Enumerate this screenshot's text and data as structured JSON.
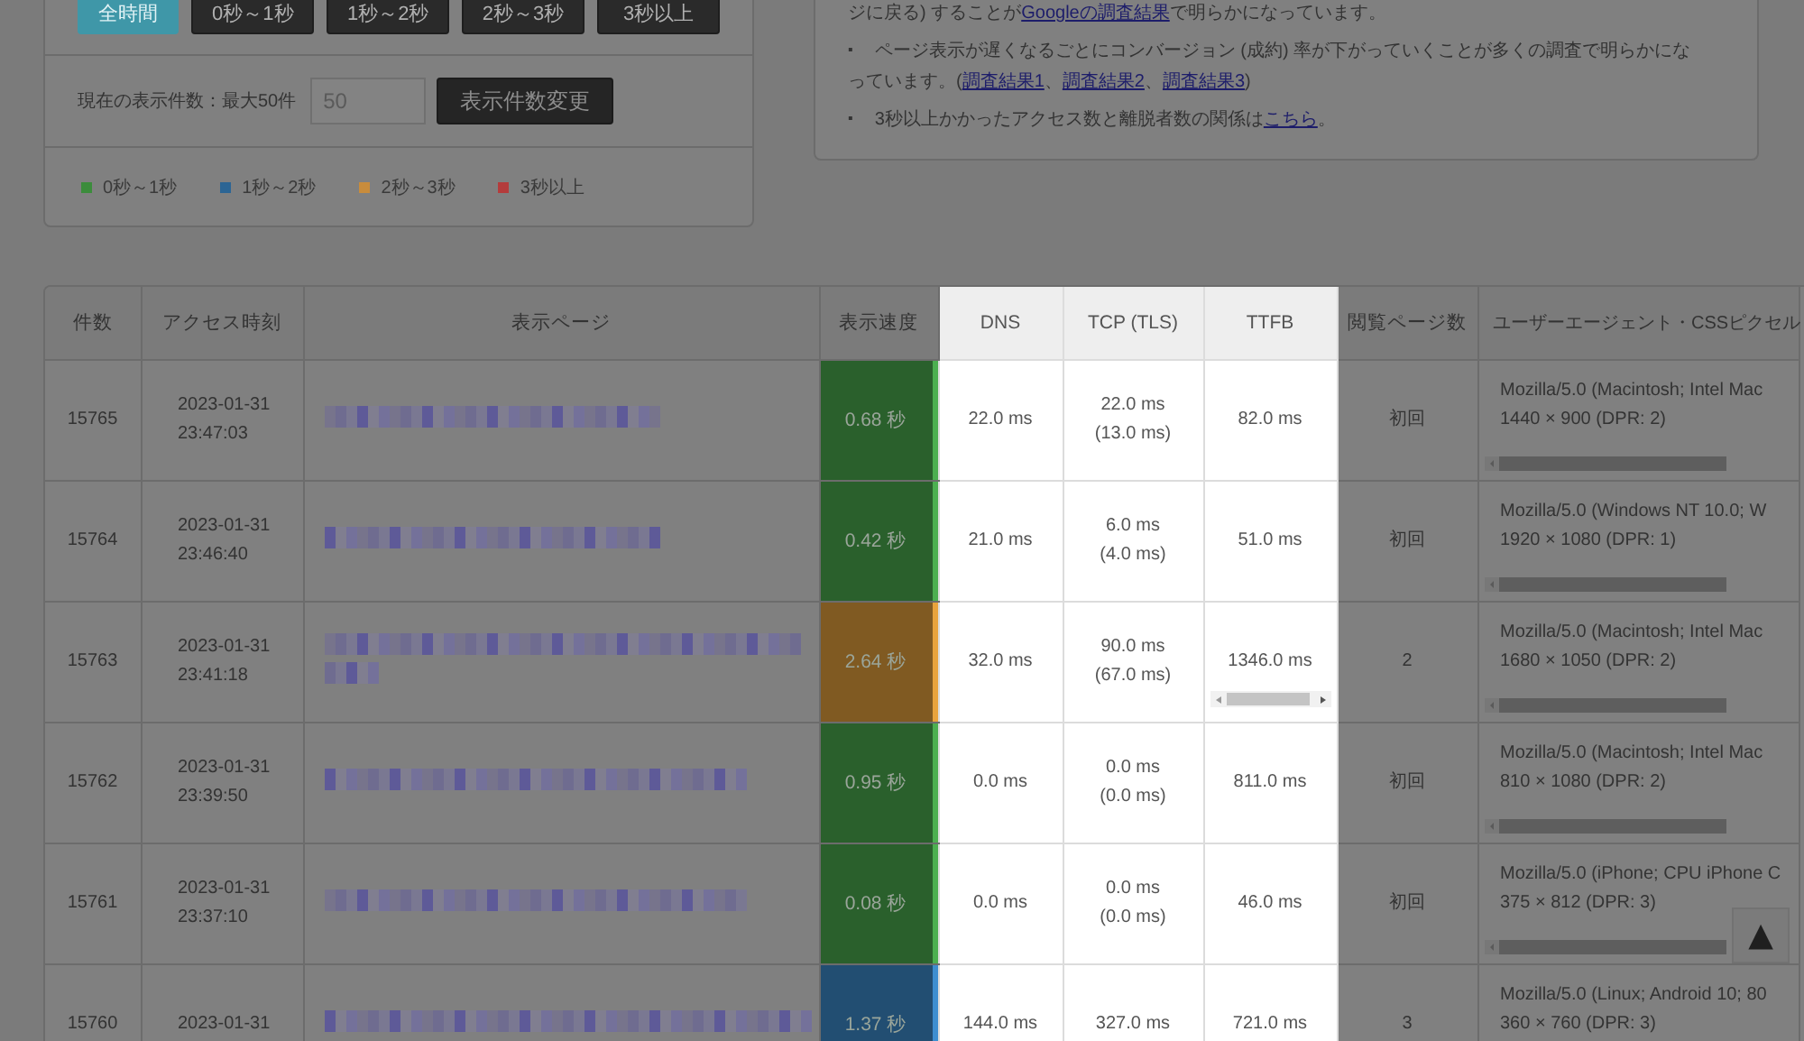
{
  "filter_buttons": [
    {
      "label": "全時間",
      "selected": true
    },
    {
      "label": "0秒～1秒",
      "selected": false
    },
    {
      "label": "1秒～2秒",
      "selected": false
    },
    {
      "label": "2秒～3秒",
      "selected": false
    },
    {
      "label": "3秒以上",
      "selected": false
    }
  ],
  "display_count": {
    "label": "現在の表示件数：最大50件",
    "value": "50",
    "button": "表示件数変更"
  },
  "legend": [
    {
      "label": "0秒～1秒",
      "color": "#3c8c3c"
    },
    {
      "label": "1秒～2秒",
      "color": "#2c6594"
    },
    {
      "label": "2秒～3秒",
      "color": "#c88c3c"
    },
    {
      "label": "3秒以上",
      "color": "#b43c3c"
    }
  ],
  "notes": [
    {
      "segments": [
        {
          "text": "ジに戻る) することが",
          "link": false
        },
        {
          "text": "Googleの調査結果",
          "link": true
        },
        {
          "text": "で明らかになっています。",
          "link": false
        }
      ]
    },
    {
      "marker": "▪",
      "segments": [
        {
          "text": "ページ表示が遅くなるごとにコンバージョン (成約) 率が下がっていくことが多くの調査で明らかになっています。(",
          "link": false
        },
        {
          "text": "調査結果1",
          "link": true
        },
        {
          "text": "、",
          "link": false
        },
        {
          "text": "調査結果2",
          "link": true
        },
        {
          "text": "、",
          "link": false
        },
        {
          "text": "調査結果3",
          "link": true
        },
        {
          "text": ")",
          "link": false
        }
      ]
    },
    {
      "marker": "▪",
      "segments": [
        {
          "text": "3秒以上かかったアクセス数と離脱者数の関係は",
          "link": false
        },
        {
          "text": "こちら",
          "link": true
        },
        {
          "text": "。",
          "link": false
        }
      ]
    }
  ],
  "table": {
    "columns": [
      {
        "label": "件数",
        "highlighted": false
      },
      {
        "label": "アクセス時刻",
        "highlighted": false
      },
      {
        "label": "表示ページ",
        "highlighted": false
      },
      {
        "label": "表示速度",
        "highlighted": false
      },
      {
        "label": "DNS",
        "highlighted": true
      },
      {
        "label": "TCP (TLS)",
        "highlighted": true
      },
      {
        "label": "TTFB",
        "highlighted": true
      },
      {
        "label": "閲覧ページ数",
        "highlighted": false
      },
      {
        "label": "ユーザーエージェント・CSSピクセル",
        "highlighted": false
      }
    ],
    "rows": [
      {
        "no": "15765",
        "date": "2023-01-31",
        "time": "23:47:03",
        "speed": "0.68 秒",
        "color": "#4caf50",
        "dns": "22.0 ms",
        "tcp": "22.0 ms",
        "tls": "(13.0 ms)",
        "ttfb": "82.0 ms",
        "ttfb_overflow": false,
        "views": "初回",
        "ua": "Mozilla/5.0 (Macintosh; Intel Mac",
        "resolution": "1440 × 900  (DPR: 2)"
      },
      {
        "no": "15764",
        "date": "2023-01-31",
        "time": "23:46:40",
        "speed": "0.42 秒",
        "color": "#4caf50",
        "dns": "21.0 ms",
        "tcp": "6.0 ms",
        "tls": "(4.0 ms)",
        "ttfb": "51.0 ms",
        "ttfb_overflow": false,
        "views": "初回",
        "ua": "Mozilla/5.0 (Windows NT 10.0; W",
        "resolution": "1920 × 1080  (DPR: 1)"
      },
      {
        "no": "15763",
        "date": "2023-01-31",
        "time": "23:41:18",
        "speed": "2.64 秒",
        "color": "#e8a33d",
        "dns": "32.0 ms",
        "tcp": "90.0 ms",
        "tls": "(67.0 ms)",
        "ttfb": "1346.0 ms",
        "ttfb_overflow": true,
        "views": "2",
        "ua": "Mozilla/5.0 (Macintosh; Intel Mac",
        "resolution": "1680 × 1050  (DPR: 2)"
      },
      {
        "no": "15762",
        "date": "2023-01-31",
        "time": "23:39:50",
        "speed": "0.95 秒",
        "color": "#4caf50",
        "dns": "0.0 ms",
        "tcp": "0.0 ms",
        "tls": "(0.0 ms)",
        "ttfb": "811.0 ms",
        "ttfb_overflow": false,
        "views": "初回",
        "ua": "Mozilla/5.0 (Macintosh; Intel Mac",
        "resolution": "810 × 1080  (DPR: 2)"
      },
      {
        "no": "15761",
        "date": "2023-01-31",
        "time": "23:37:10",
        "speed": "0.08 秒",
        "color": "#4caf50",
        "dns": "0.0 ms",
        "tcp": "0.0 ms",
        "tls": "(0.0 ms)",
        "ttfb": "46.0 ms",
        "ttfb_overflow": false,
        "views": "初回",
        "ua": "Mozilla/5.0 (iPhone; CPU iPhone C",
        "resolution": "375 × 812  (DPR: 3)"
      },
      {
        "no": "15760",
        "date": "2023-01-31",
        "speed": "1.37 秒",
        "color": "#3e8ed0",
        "dns": "144.0 ms",
        "tcp": "327.0 ms",
        "ttfb": "721.0 ms",
        "ttfb_overflow": false,
        "views": "3",
        "ua": "Mozilla/5.0 (Linux; Android 10; 80",
        "resolution": "360 × 760  (DPR: 3)"
      }
    ]
  },
  "back_to_top": "▲"
}
